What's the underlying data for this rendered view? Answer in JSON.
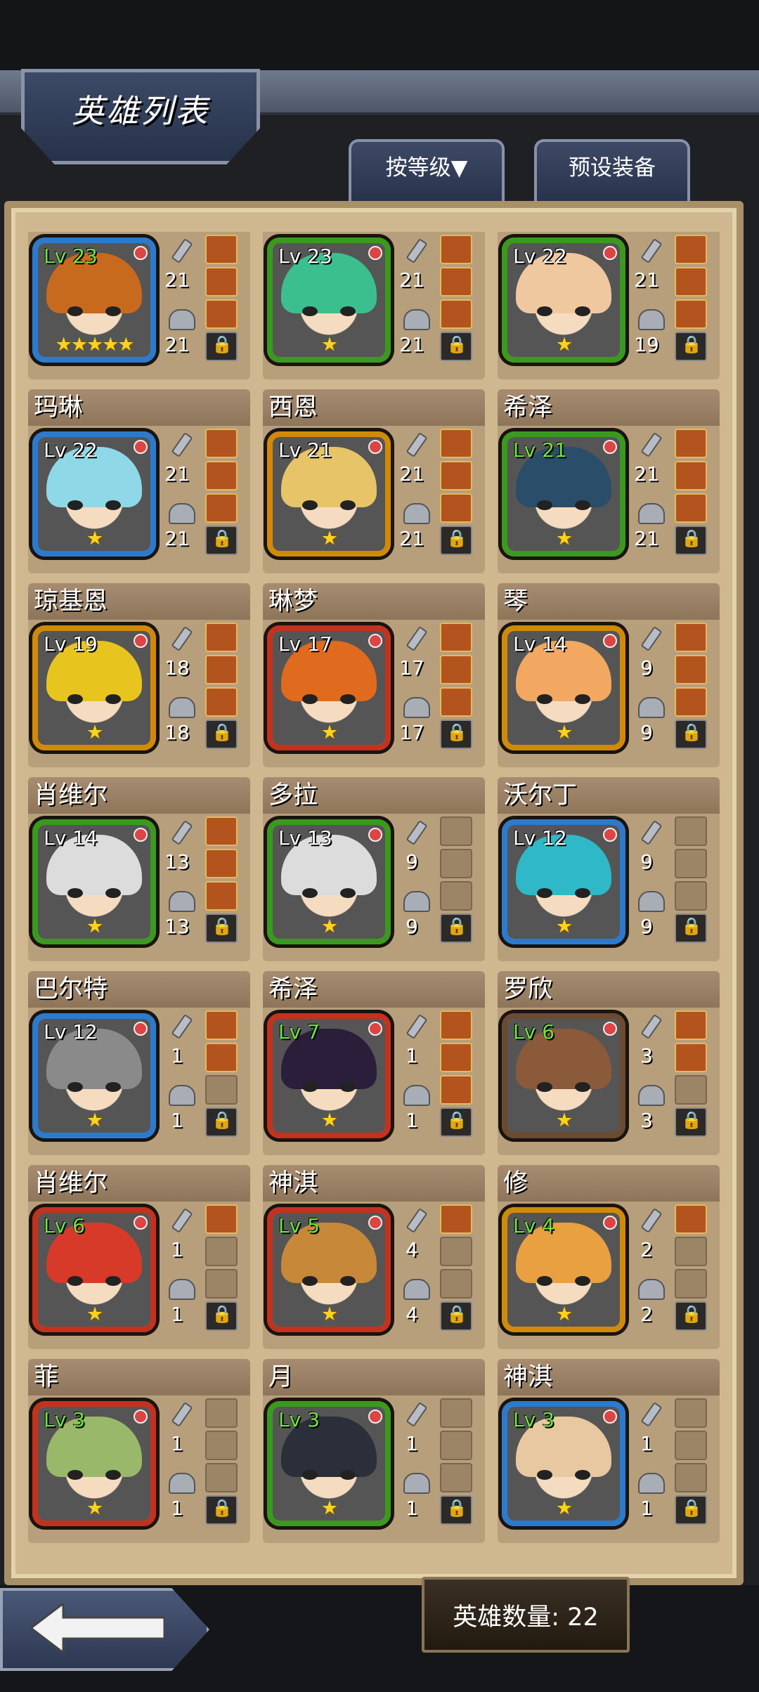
{
  "header": {
    "title": "英雄列表"
  },
  "tabs": {
    "sort_label": "按等级▼",
    "preset_label": "预设装备"
  },
  "footer": {
    "count_label": "英雄数量: 22"
  },
  "heroes": [
    {
      "name": "",
      "level": "Lv 23",
      "stars": "★★★★★",
      "atk": "21",
      "def": "21"
    },
    {
      "name": "",
      "level": "Lv 23",
      "stars": "★",
      "atk": "21",
      "def": "21"
    },
    {
      "name": "",
      "level": "Lv 22",
      "stars": "★",
      "atk": "21",
      "def": "19"
    },
    {
      "name": "玛琳",
      "level": "Lv 22",
      "stars": "★",
      "atk": "21",
      "def": "21"
    },
    {
      "name": "西恩",
      "level": "Lv 21",
      "stars": "★",
      "atk": "21",
      "def": "21"
    },
    {
      "name": "希泽",
      "level": "Lv 21",
      "stars": "★",
      "atk": "21",
      "def": "21"
    },
    {
      "name": "琼基恩",
      "level": "Lv 19",
      "stars": "★",
      "atk": "18",
      "def": "18"
    },
    {
      "name": "琳梦",
      "level": "Lv 17",
      "stars": "★",
      "atk": "17",
      "def": "17"
    },
    {
      "name": "琴",
      "level": "Lv 14",
      "stars": "★",
      "atk": "9",
      "def": "9"
    },
    {
      "name": "肖维尔",
      "level": "Lv 14",
      "stars": "★",
      "atk": "13",
      "def": "13"
    },
    {
      "name": "多拉",
      "level": "Lv 13",
      "stars": "★",
      "atk": "9",
      "def": "9"
    },
    {
      "name": "沃尔丁",
      "level": "Lv 12",
      "stars": "★",
      "atk": "9",
      "def": "9"
    },
    {
      "name": "巴尔特",
      "level": "Lv 12",
      "stars": "★",
      "atk": "1",
      "def": "1"
    },
    {
      "name": "希泽",
      "level": "Lv 7",
      "stars": "★",
      "atk": "1",
      "def": "1"
    },
    {
      "name": "罗欣",
      "level": "Lv 6",
      "stars": "★",
      "atk": "3",
      "def": "3"
    },
    {
      "name": "肖维尔",
      "level": "Lv 6",
      "stars": "★",
      "atk": "1",
      "def": "1"
    },
    {
      "name": "神淇",
      "level": "Lv 5",
      "stars": "★",
      "atk": "4",
      "def": "4"
    },
    {
      "name": "修",
      "level": "Lv 4",
      "stars": "★",
      "atk": "2",
      "def": "2"
    },
    {
      "name": "菲",
      "level": "Lv 3",
      "stars": "★",
      "atk": "1",
      "def": "1"
    },
    {
      "name": "月",
      "level": "Lv 3",
      "stars": "★",
      "atk": "1",
      "def": "1"
    },
    {
      "name": "神淇",
      "level": "Lv 3",
      "stars": "★",
      "atk": "1",
      "def": "1"
    }
  ]
}
